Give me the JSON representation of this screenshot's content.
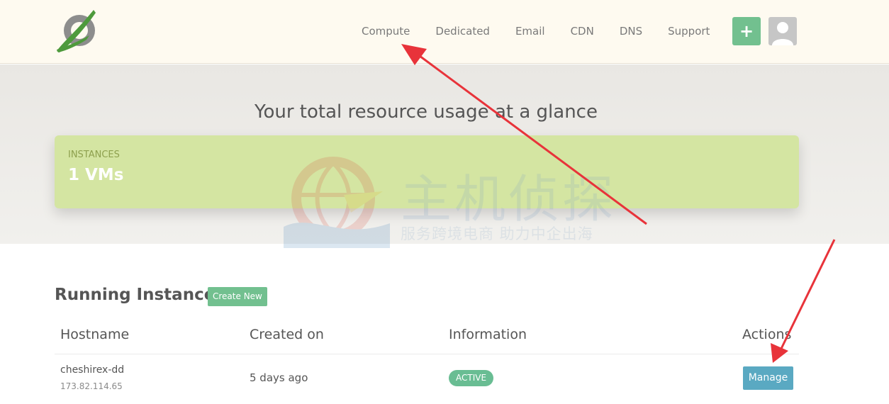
{
  "header": {
    "nav": [
      "Compute",
      "Dedicated",
      "Email",
      "CDN",
      "DNS",
      "Support"
    ],
    "add_label": "+"
  },
  "hero": {
    "title": "Your total resource usage at a glance",
    "usage_label": "INSTANCES",
    "usage_value": "1 VMs"
  },
  "watermark": {
    "line1": "主机侦探",
    "line2": "服务跨境电商 助力中企出海"
  },
  "instances": {
    "title": "Running Instances",
    "create_label": "Create New",
    "columns": [
      "Hostname",
      "Created on",
      "Information",
      "Actions"
    ],
    "rows": [
      {
        "hostname": "cheshirex-dd",
        "ip": "173.82.114.65",
        "created": "5 days ago",
        "status": "ACTIVE",
        "action": "Manage"
      }
    ]
  },
  "colors": {
    "accent_green": "#72c08f",
    "card_green": "#d4e5a2",
    "manage_blue": "#5aa9c2",
    "annotation_red": "#e8333a"
  }
}
